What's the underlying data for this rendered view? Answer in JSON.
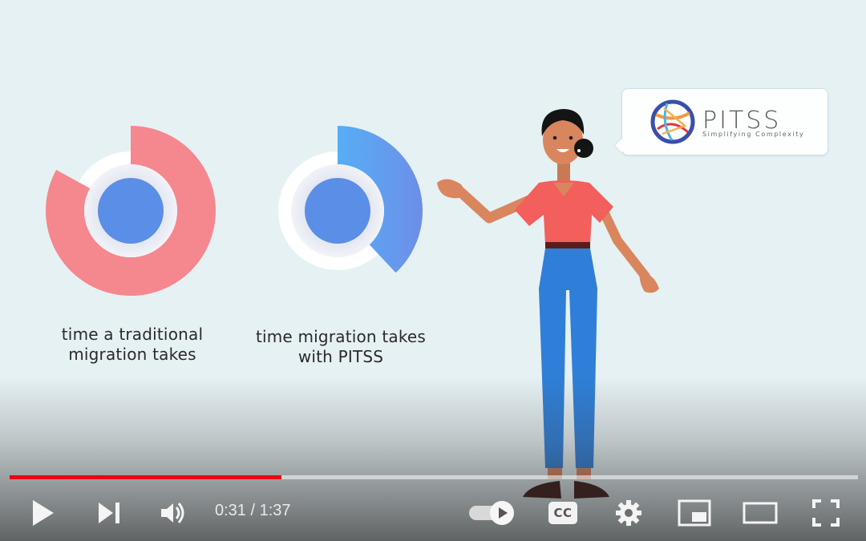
{
  "video": {
    "captions": {
      "left": "time a traditional migration takes",
      "right": "time migration takes with PITSS"
    },
    "logo": {
      "name": "PITSS",
      "tagline": "Simplifying Complexity"
    },
    "donuts": [
      {
        "name": "traditional",
        "fraction": 0.83,
        "color": "#f5848f"
      },
      {
        "name": "pitss",
        "fraction": 0.38,
        "color": "#5b9cf0"
      }
    ],
    "colors": {
      "progress_played": "#e50914",
      "shirt": "#f25f5c",
      "pants": "#2f7fd8"
    }
  },
  "player": {
    "current_time": "0:31",
    "duration": "1:37",
    "time_display": "0:31 / 1:37",
    "progress_fraction": 0.32,
    "autoplay_on": true,
    "icons": {
      "play": "play-icon",
      "next": "next-icon",
      "volume": "volume-icon",
      "autoplay": "autoplay-toggle-icon",
      "cc": "CC",
      "settings": "gear-icon",
      "miniplayer": "miniplayer-icon",
      "theater": "theater-icon",
      "fullscreen": "fullscreen-icon"
    }
  }
}
